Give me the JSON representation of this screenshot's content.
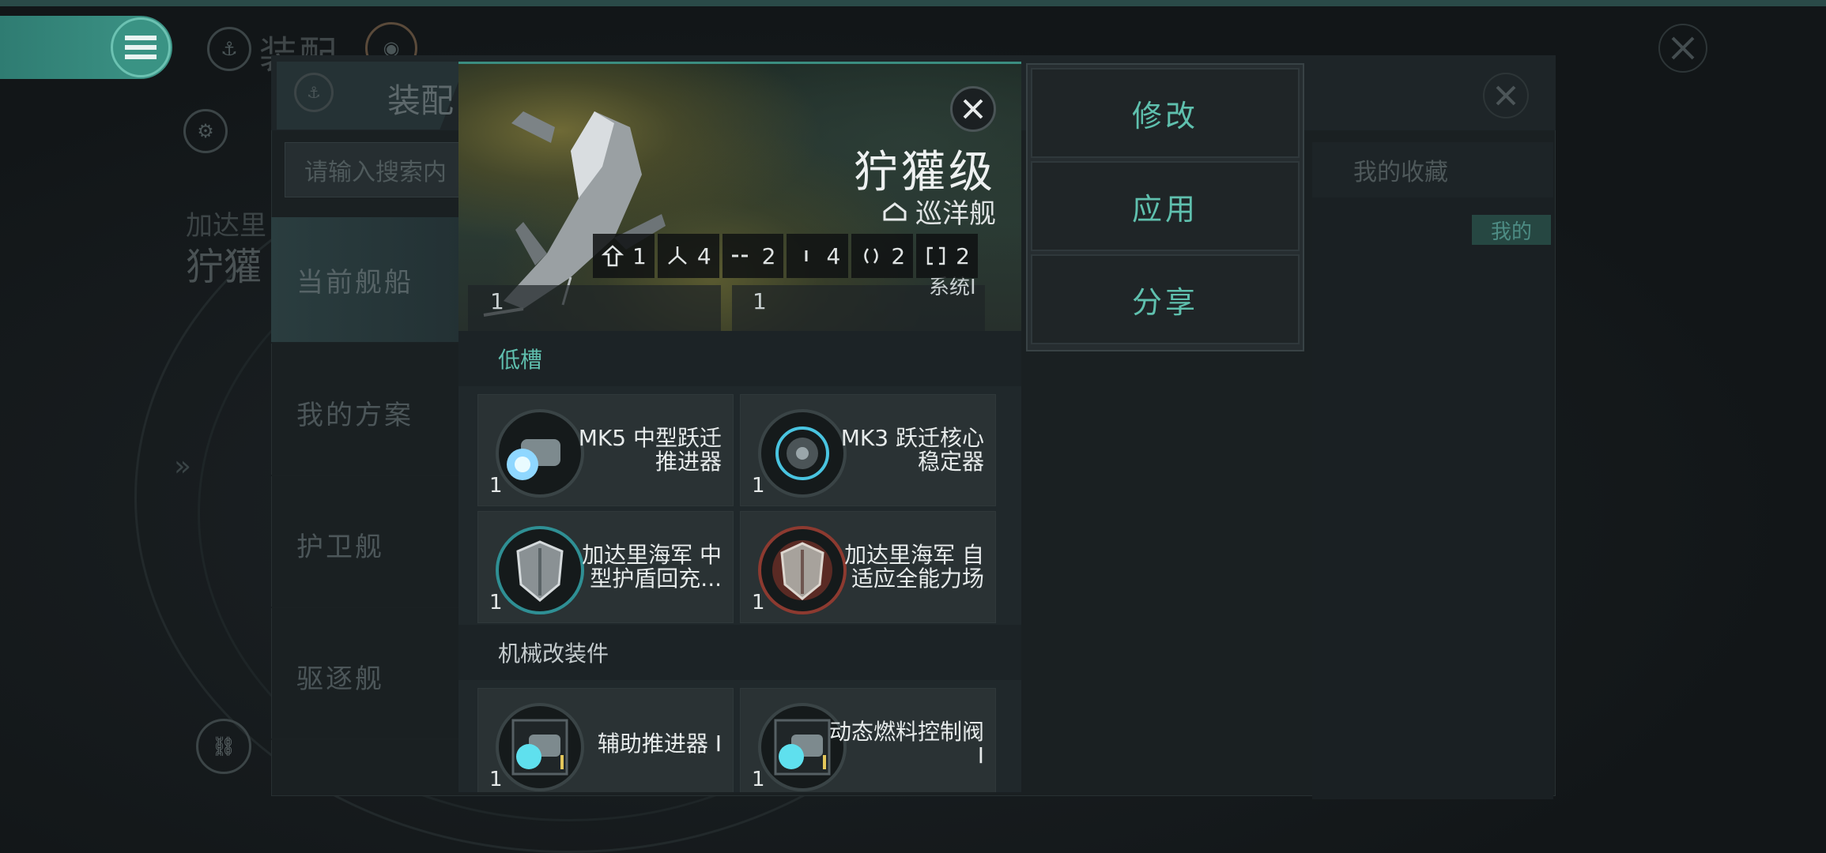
{
  "background": {
    "title": "装配",
    "sub_text_1": "加达里",
    "sub_text_2": "狞獾"
  },
  "fitting_panel": {
    "title": "装配",
    "search_placeholder": "请输入搜索内",
    "sidebar": [
      {
        "label": "当前舰船",
        "active": true
      },
      {
        "label": "我的方案"
      },
      {
        "label": "护卫舰"
      },
      {
        "label": "驱逐舰"
      }
    ],
    "favorites_label": "我的收藏",
    "mine_tag": "我的"
  },
  "ship_detail": {
    "name": "狞獾级",
    "class": "巡洋舰",
    "stats": [
      {
        "icon": "drone-icon",
        "value": "1"
      },
      {
        "icon": "turret-icon",
        "value": "4"
      },
      {
        "icon": "high-slot-icon",
        "value": "2"
      },
      {
        "icon": "mid-slot-icon",
        "value": "4"
      },
      {
        "icon": "low-slot-icon",
        "value": "2"
      },
      {
        "icon": "rig-slot-icon",
        "value": "2"
      }
    ],
    "peek_left_qty": "1",
    "peek_right_qty": "1",
    "peek_right_text": "系统I",
    "sections": {
      "low_slots": {
        "title": "低槽",
        "modules": [
          {
            "name": "MK5 中型跃迁推进器",
            "qty": "1",
            "icon": "propulsion-icon"
          },
          {
            "name": "MK3 跃迁核心稳定器",
            "qty": "1",
            "icon": "stabilizer-icon"
          },
          {
            "name": "加达里海军 中型护盾回充...",
            "qty": "1",
            "icon": "shield-icon"
          },
          {
            "name": "加达里海军 自适应全能力场",
            "qty": "1",
            "icon": "shield-hardener-icon"
          }
        ]
      },
      "rigs": {
        "title": "机械改装件",
        "modules": [
          {
            "name": "辅助推进器 I",
            "qty": "1",
            "icon": "thruster-rig-icon"
          },
          {
            "name": "动态燃料控制阀 I",
            "qty": "1",
            "icon": "fuel-valve-rig-icon"
          }
        ]
      }
    }
  },
  "actions": [
    {
      "label": "修改"
    },
    {
      "label": "应用"
    },
    {
      "label": "分享"
    }
  ],
  "colors": {
    "accent": "#5fc0ae",
    "menu_teal": "#3a9384"
  }
}
